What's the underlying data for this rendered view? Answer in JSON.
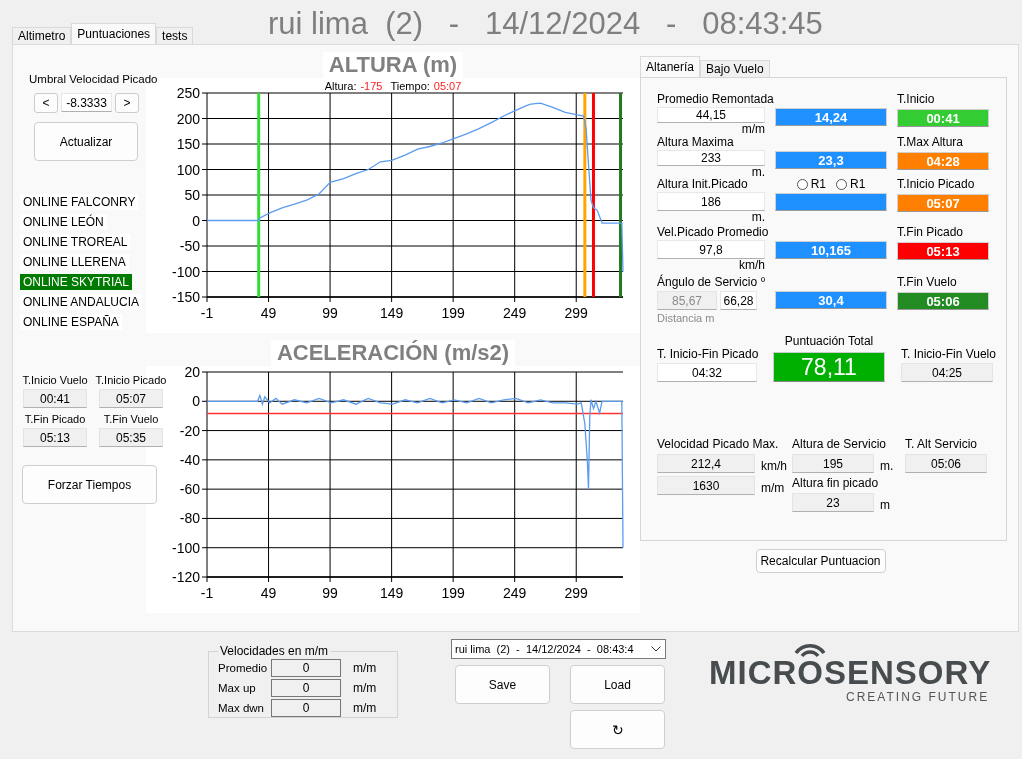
{
  "tabs": [
    {
      "label": "Altimetro",
      "selected": false
    },
    {
      "label": "Puntuaciones",
      "selected": true
    },
    {
      "label": "tests",
      "selected": false
    }
  ],
  "title": "rui lima  (2)   -   14/12/2024   -   08:43:45",
  "left": {
    "threshold": {
      "label": "Umbral Velocidad Picado",
      "dec": "<",
      "value": "-8.3333",
      "inc": ">"
    },
    "update_button": "Actualizar",
    "events": [
      {
        "label": "ONLINE FALCONRY",
        "selected": false
      },
      {
        "label": "ONLINE LEÓN",
        "selected": false
      },
      {
        "label": "ONLINE TROREAL",
        "selected": false
      },
      {
        "label": "ONLINE LLERENA",
        "selected": false
      },
      {
        "label": "ONLINE SKYTRIAL",
        "selected": true
      },
      {
        "label": "ONLINE ANDALUCIA",
        "selected": false
      },
      {
        "label": "ONLINE ESPAÑA",
        "selected": false
      }
    ],
    "times": [
      {
        "label": "T.Inicio Vuelo",
        "value": "00:41"
      },
      {
        "label": "T.Inicio Picado",
        "value": "05:07"
      },
      {
        "label": "T.Fin Picado",
        "value": "05:13"
      },
      {
        "label": "T.Fin Vuelo",
        "value": "05:35"
      }
    ],
    "force_button": "Forzar Tiempos"
  },
  "charts": [
    {
      "title": "ALTURA (m)",
      "cursor": [
        {
          "label": "Altura:",
          "value": "-175"
        },
        {
          "label": "Tiempo:",
          "value": "05:07"
        }
      ],
      "chart_data": {
        "type": "line",
        "xlim": [
          -1,
          337
        ],
        "ylim": [
          -150,
          250
        ],
        "xticks": [
          -1,
          49,
          99,
          149,
          199,
          249,
          299
        ],
        "yticks": [
          -150,
          -100,
          -50,
          0,
          50,
          100,
          150,
          200,
          250
        ],
        "x": [
          -1,
          10,
          20,
          41,
          42,
          50,
          60,
          70,
          80,
          90,
          99,
          110,
          120,
          130,
          140,
          149,
          160,
          170,
          180,
          190,
          199,
          210,
          220,
          230,
          240,
          249,
          258,
          262,
          270,
          280,
          290,
          300,
          305,
          307,
          309,
          311,
          313,
          316,
          320,
          330,
          335,
          336,
          337
        ],
        "series": [
          {
            "color": "#5b9cf0",
            "values": [
              0,
              0,
              0,
              0,
              5,
              15,
              25,
              32,
              40,
              52,
              75,
              82,
              92,
              100,
              115,
              118,
              128,
              140,
              145,
              152,
              160,
              170,
              180,
              192,
              205,
              215,
              225,
              228,
              230,
              222,
              212,
              207,
              205,
              180,
              110,
              40,
              25,
              20,
              -5,
              -5,
              -5,
              -5,
              -100
            ]
          }
        ],
        "grid": true,
        "ref_lines": [
          {
            "axis": "x",
            "value": 41,
            "color": "#33dd33"
          },
          {
            "axis": "x",
            "value": 306,
            "color": "#ffa500"
          },
          {
            "axis": "x",
            "value": 313,
            "color": "#ff0000"
          },
          {
            "axis": "x",
            "value": 335,
            "color": "#1e7b1e"
          }
        ]
      }
    },
    {
      "title": "ACELERACIÓN (m/s2)",
      "chart_data": {
        "type": "line",
        "xlim": [
          -1,
          337
        ],
        "ylim": [
          -120,
          20
        ],
        "xticks": [
          -1,
          49,
          99,
          149,
          199,
          249,
          299
        ],
        "yticks": [
          -120,
          -100,
          -80,
          -60,
          -40,
          -20,
          0,
          20
        ],
        "x": [
          -1,
          5,
          30,
          40,
          42,
          44,
          46,
          50,
          55,
          60,
          70,
          80,
          90,
          100,
          110,
          120,
          130,
          140,
          150,
          160,
          170,
          180,
          190,
          200,
          210,
          220,
          230,
          240,
          250,
          260,
          270,
          280,
          290,
          300,
          303,
          306,
          308,
          309,
          310,
          311,
          313,
          315,
          318,
          320,
          325,
          330,
          335,
          336,
          337
        ],
        "series": [
          {
            "color": "#5b9cf0",
            "values": [
              0,
              0,
              0,
              0,
              4,
              -2,
              3,
              -1,
              2,
              -2,
              1,
              -1,
              2,
              -1,
              1,
              -2,
              2,
              -1,
              -2,
              1,
              -1,
              2,
              -1,
              1,
              -1,
              2,
              -1,
              1,
              2,
              -1,
              1,
              -1,
              -1,
              -2,
              -1,
              -15,
              -40,
              -60,
              -10,
              1,
              -5,
              0,
              -8,
              0,
              0,
              0,
              0,
              0,
              -100
            ]
          }
        ],
        "grid": true,
        "ref_lines": [
          {
            "axis": "y",
            "value": -8.3333,
            "color": "#ff3030"
          }
        ]
      }
    }
  ],
  "score_panel": {
    "tabs": [
      {
        "label": "Altanería",
        "selected": true
      },
      {
        "label": "Bajo Vuelo",
        "selected": false
      }
    ],
    "measures": [
      {
        "kind": "single",
        "label": "Promedio Remontada",
        "fields": [
          {
            "value": "44,15",
            "disabled": false
          }
        ],
        "unit": "m/m"
      },
      {
        "kind": "single",
        "label": "Altura Maxima",
        "fields": [
          {
            "value": "233",
            "disabled": false
          }
        ],
        "unit": "m."
      },
      {
        "kind": "single",
        "label": "Altura Init.Picado",
        "fields": [
          {
            "value": "186",
            "disabled": false
          }
        ],
        "unit": "m."
      },
      {
        "kind": "single",
        "label": "Vel.Picado Promedio",
        "fields": [
          {
            "value": "97,8",
            "disabled": false
          }
        ],
        "unit": "km/h"
      },
      {
        "kind": "double",
        "label": "Ángulo de Servicio",
        "fields": [
          {
            "value": "85,67",
            "disabled": true
          },
          {
            "value": "66,28",
            "disabled": false
          }
        ],
        "unit": "º",
        "note": "Distancia m"
      }
    ],
    "scores": [
      {
        "value": "14,24"
      },
      {
        "value": "23,3"
      },
      {
        "radios": [
          {
            "label": "R1",
            "selected": false
          },
          {
            "label": "R1",
            "selected": false
          }
        ]
      },
      {
        "value": "10,165"
      },
      {
        "value": "30,4"
      }
    ],
    "times": [
      {
        "label": "T.Inicio",
        "value": "00:41",
        "color": "#33cc33"
      },
      {
        "label": "T.Max Altura",
        "value": "04:28",
        "color": "#ff8000"
      },
      {
        "label": "T.Inicio Picado",
        "value": "05:07",
        "color": "#ff8000"
      },
      {
        "label": "T.Fin Picado",
        "value": "05:13",
        "color": "#ff0000"
      },
      {
        "label": "T.Fin Vuelo",
        "value": "05:06",
        "color": "#228b22"
      }
    ],
    "summary": {
      "left": {
        "label": "T. Inicio-Fin Picado",
        "value": "04:32"
      },
      "total": {
        "label": "Puntuación Total",
        "value": "78,11"
      },
      "right": {
        "label": "T. Inicio-Fin Vuelo",
        "value": "04:25"
      }
    },
    "stat_columns": [
      [
        {
          "label": "Velocidad Picado Max.",
          "value": "212,4",
          "unit": "km/h"
        },
        {
          "value": "1630",
          "unit": "m/m"
        }
      ],
      [
        {
          "label": "Altura de Servicio",
          "value": "195",
          "unit": "m."
        },
        {
          "label": "Altura fin picado",
          "value": "23",
          "unit": "m"
        }
      ],
      [
        {
          "label": "T. Alt Servicio",
          "value": "05:06"
        }
      ]
    ],
    "button": "Recalcular Puntuacion"
  },
  "speeds": {
    "title": "Velocidades en m/m",
    "rows": [
      {
        "label": "Promedio",
        "value": "0",
        "unit": "m/m"
      },
      {
        "label": "Max up",
        "value": "0",
        "unit": "m/m"
      },
      {
        "label": "Max dwn",
        "value": "0",
        "unit": "m/m"
      }
    ]
  },
  "session": {
    "selected": "rui lima  (2)  -  14/12/2024  -  08:43:4",
    "buttons": [
      "Save",
      "Load",
      "↻"
    ]
  },
  "logo": {
    "name": "MICROSENSORY",
    "tagline": "CREATING FUTURE"
  }
}
